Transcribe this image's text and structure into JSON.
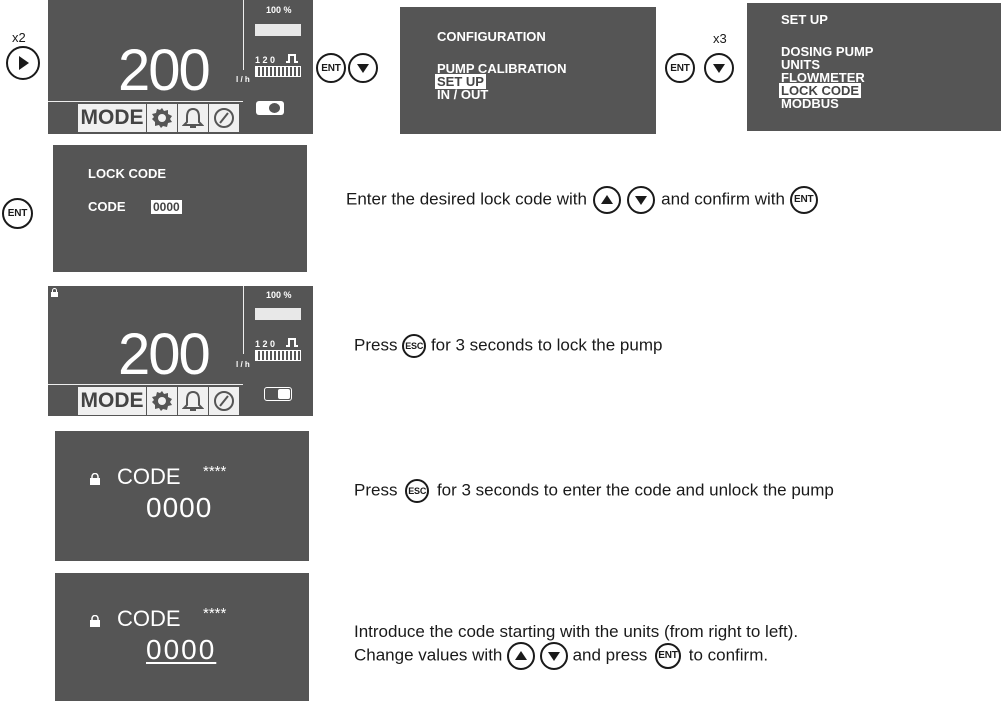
{
  "step1": {
    "multiplier": "x2",
    "display": {
      "flow_value": "200",
      "flow_unit": "l / h",
      "percent_label": "100 %",
      "pulse_label": "1 2 0",
      "mode_label": "MODE",
      "lock_state": "unlocked"
    }
  },
  "step2": {
    "enter_label": "ENT",
    "menu": {
      "title": "CONFIGURATION",
      "items": [
        "PUMP CALIBRATION",
        "SET UP",
        "IN / OUT"
      ],
      "selected_index": 1
    }
  },
  "step3": {
    "multiplier": "x3",
    "enter_label": "ENT",
    "menu": {
      "title": "SET UP",
      "items": [
        "DOSING  PUMP",
        "UNITS",
        "FLOWMETER",
        "LOCK CODE",
        "MODBUS"
      ],
      "selected_index": 3
    }
  },
  "step4": {
    "enter_label": "ENT",
    "screen": {
      "title": "LOCK CODE",
      "code_label": "CODE",
      "code_value": "0000"
    },
    "instruction": {
      "part1": "Enter the desired lock code with",
      "part2": "and confirm with",
      "enter_label": "ENT"
    }
  },
  "step5": {
    "display": {
      "flow_value": "200",
      "flow_unit": "l / h",
      "percent_label": "100 %",
      "pulse_label": "1 2 0",
      "mode_label": "MODE",
      "lock_state": "locked"
    },
    "instruction": {
      "part1": "Press",
      "esc_label": "ESC",
      "part2": "for 3 seconds to lock the pump"
    }
  },
  "step6": {
    "screen": {
      "code_label": "CODE",
      "stars": "****",
      "code_value": "0000"
    },
    "instruction": {
      "part1": "Press",
      "esc_label": "ESC",
      "part2": "for 3 seconds to enter the code and unlock the pump"
    }
  },
  "step7": {
    "screen": {
      "code_label": "CODE",
      "stars": "****",
      "code_value": "0000"
    },
    "instruction": {
      "line1": "Introduce the code starting with the units (from right to left).",
      "line2_part1": "Change values with",
      "line2_part2": "and press",
      "enter_label": "ENT",
      "line2_part3": "to confirm."
    }
  },
  "colors": {
    "screen_bg": "#555555",
    "screen_text": "#ffffff",
    "highlight_bg": "#ffffff"
  }
}
